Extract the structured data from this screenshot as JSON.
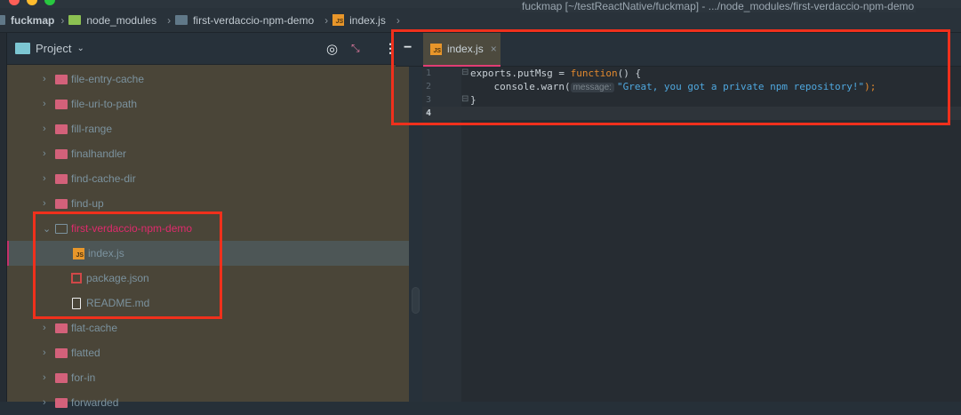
{
  "window": {
    "title": "fuckmap [~/testReactNative/fuckmap] - .../node_modules/first-verdaccio-npm-demo"
  },
  "breadcrumb": [
    "fuckmap",
    "node_modules",
    "first-verdaccio-npm-demo",
    "index.js"
  ],
  "project_panel": {
    "title": "Project",
    "tree": [
      {
        "label": "file-entry-cache",
        "type": "folder"
      },
      {
        "label": "file-uri-to-path",
        "type": "folder"
      },
      {
        "label": "fill-range",
        "type": "folder"
      },
      {
        "label": "finalhandler",
        "type": "folder"
      },
      {
        "label": "find-cache-dir",
        "type": "folder"
      },
      {
        "label": "find-up",
        "type": "folder"
      },
      {
        "label": "first-verdaccio-npm-demo",
        "type": "open-folder"
      },
      {
        "label": "index.js",
        "type": "js"
      },
      {
        "label": "package.json",
        "type": "npm"
      },
      {
        "label": "README.md",
        "type": "md"
      },
      {
        "label": "flat-cache",
        "type": "folder"
      },
      {
        "label": "flatted",
        "type": "folder"
      },
      {
        "label": "for-in",
        "type": "folder"
      },
      {
        "label": "forwarded",
        "type": "folder"
      }
    ]
  },
  "editor": {
    "tab": "index.js",
    "line_numbers": [
      "1",
      "2",
      "3",
      "4"
    ],
    "code": {
      "l1a": "exports.putMsg = ",
      "l1kw": "function",
      "l1b": "() {",
      "l2a": "    console.warn(",
      "l2hint": "message:",
      "l2str": "\"Great, you got a private npm repository!\"",
      "l2end": ");",
      "l3": "}"
    }
  },
  "colors": {
    "highlight": "#f0301c",
    "accent": "#e23d74"
  }
}
